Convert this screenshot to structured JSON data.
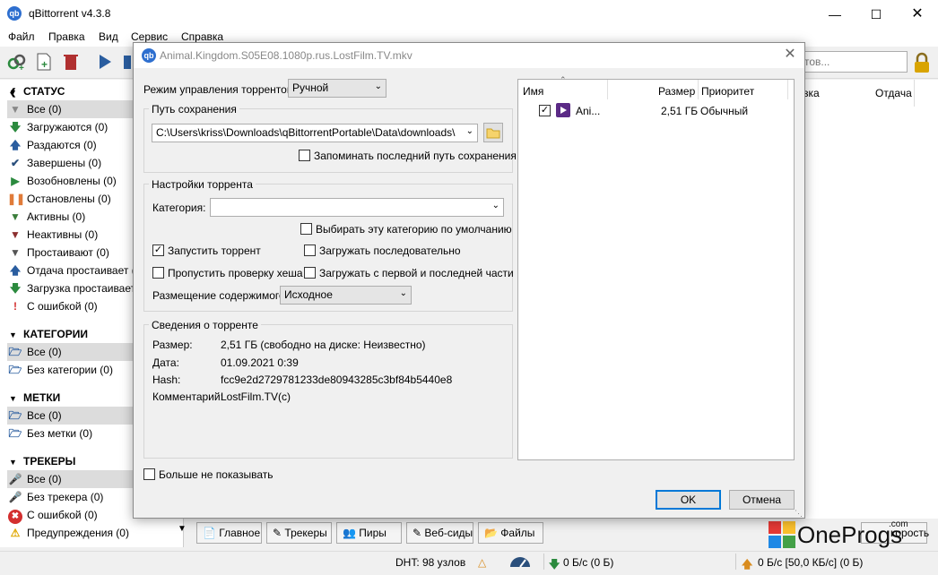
{
  "window": {
    "title": "qBittorrent v4.3.8",
    "app_icon_text": "qb"
  },
  "menu": [
    "Файл",
    "Правка",
    "Вид",
    "Сервис",
    "Справка"
  ],
  "search": {
    "placeholder": "рентов..."
  },
  "sidebar": {
    "status": {
      "header": "СТАТУС",
      "items": [
        {
          "label": "Все (0)",
          "icon": "filter-icon"
        },
        {
          "label": "Загружаются (0)",
          "icon": "arrow-down-icon"
        },
        {
          "label": "Раздаются (0)",
          "icon": "arrow-up-icon"
        },
        {
          "label": "Завершены (0)",
          "icon": "checkmark-icon"
        },
        {
          "label": "Возобновлены (0)",
          "icon": "play-icon"
        },
        {
          "label": "Остановлены (0)",
          "icon": "pause-icon"
        },
        {
          "label": "Активны (0)",
          "icon": "filter-icon"
        },
        {
          "label": "Неактивны (0)",
          "icon": "filter-icon"
        },
        {
          "label": "Простаивают (0)",
          "icon": "filter-icon"
        },
        {
          "label": "Отдача простаивает (0)",
          "icon": "arrow-up-icon"
        },
        {
          "label": "Загрузка простаивает (0)",
          "icon": "arrow-down-icon"
        },
        {
          "label": "С ошибкой (0)",
          "icon": "exclamation-icon"
        }
      ]
    },
    "categories": {
      "header": "КАТЕГОРИИ",
      "items": [
        {
          "label": "Все (0)"
        },
        {
          "label": "Без категории (0)"
        }
      ]
    },
    "tags": {
      "header": "МЕТКИ",
      "items": [
        {
          "label": "Все (0)"
        },
        {
          "label": "Без метки (0)"
        }
      ]
    },
    "trackers": {
      "header": "ТРЕКЕРЫ",
      "items": [
        {
          "label": "Все (0)"
        },
        {
          "label": "Без трекера (0)"
        },
        {
          "label": "С ошибкой (0)"
        },
        {
          "label": "Предупреждения (0)"
        }
      ]
    }
  },
  "mainlist": {
    "col_partial": "зка",
    "col_upload": "Отдача"
  },
  "bottom_tabs": [
    "Главное",
    "Трекеры",
    "Пиры",
    "Веб-сиды",
    "Файлы"
  ],
  "speed_tab_partial": "корость",
  "statusbar": {
    "dht": "DHT: 98 узлов",
    "down": "0 Б/с (0 Б)",
    "up": "0 Б/с [50,0 КБ/с] (0 Б)"
  },
  "watermark": {
    "text": "OneProgs",
    "suffix": ".com"
  },
  "dialog": {
    "title": "Animal.Kingdom.S05E08.1080p.rus.LostFilm.TV.mkv",
    "management_label": "Режим управления торрентом:",
    "management_value": "Ручной",
    "save_group_title": "Путь сохранения",
    "save_path": "C:\\Users\\kriss\\Downloads\\qBittorrentPortable\\Data\\downloads\\",
    "remember_path_label": "Запоминать последний путь сохранения",
    "remember_path_checked": false,
    "settings_group_title": "Настройки торрента",
    "category_label": "Категория:",
    "category_value": "",
    "default_category_label": "Выбирать эту категорию по умолчанию",
    "default_category_checked": false,
    "start_torrent_label": "Запустить торрент",
    "start_torrent_checked": true,
    "sequential_label": "Загружать последовательно",
    "sequential_checked": false,
    "skip_hash_label": "Пропустить проверку хеша",
    "skip_hash_checked": false,
    "first_last_label": "Загружать с первой и последней части",
    "first_last_checked": false,
    "layout_label": "Размещение содержимого:",
    "layout_value": "Исходное",
    "info_group_title": "Сведения о торренте",
    "info": [
      {
        "key": "Размер:",
        "value": "2,51 ГБ (свободно на диске: Неизвестно)"
      },
      {
        "key": "Дата:",
        "value": "01.09.2021 0:39"
      },
      {
        "key": "Hash:",
        "value": "fcc9e2d2729781233de80943285c3bf84b5440e8"
      },
      {
        "key": "Комментарий:",
        "value": "LostFilm.TV(c)"
      }
    ],
    "dont_show_label": "Больше не показывать",
    "dont_show_checked": false,
    "files": {
      "headers": [
        "Имя",
        "Размер",
        "Приоритет"
      ],
      "rows": [
        {
          "checked": true,
          "name": "Ani...",
          "size": "2,51 ГБ",
          "priority": "Обычный"
        }
      ]
    },
    "ok_label": "OK",
    "cancel_label": "Отмена"
  }
}
